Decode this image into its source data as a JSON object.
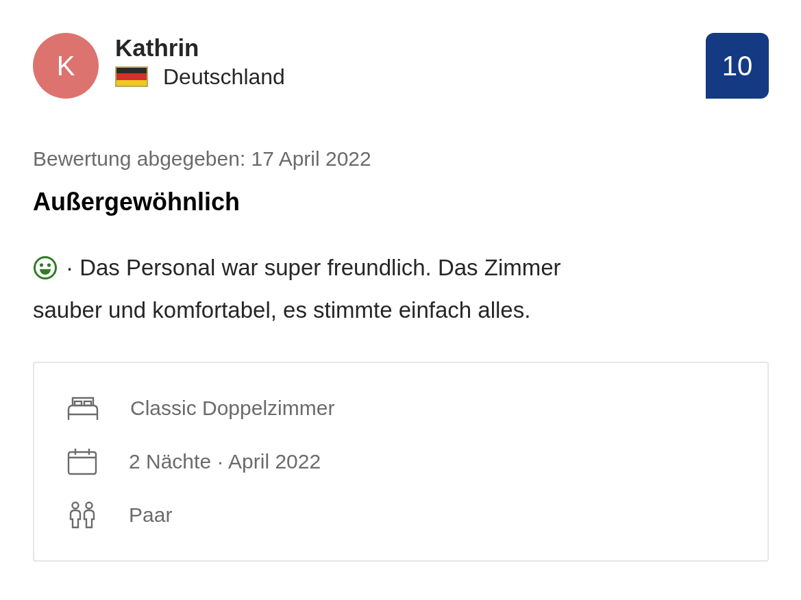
{
  "reviewer": {
    "initial": "K",
    "name": "Kathrin",
    "country": "Deutschland"
  },
  "score": "10",
  "review": {
    "date": "Bewertung abgegeben: 17 April 2022",
    "title": "Außergewöhnlich",
    "text_lines": [
      "· Das Personal war super freundlich. Das Zimmer",
      "sauber und komfortabel, es stimmte einfach alles."
    ]
  },
  "details": [
    {
      "kind": "room",
      "text": "Classic Doppelzimmer"
    },
    {
      "kind": "stay",
      "text": "2 Nächte · April 2022"
    },
    {
      "kind": "group",
      "text": "Paar"
    }
  ]
}
